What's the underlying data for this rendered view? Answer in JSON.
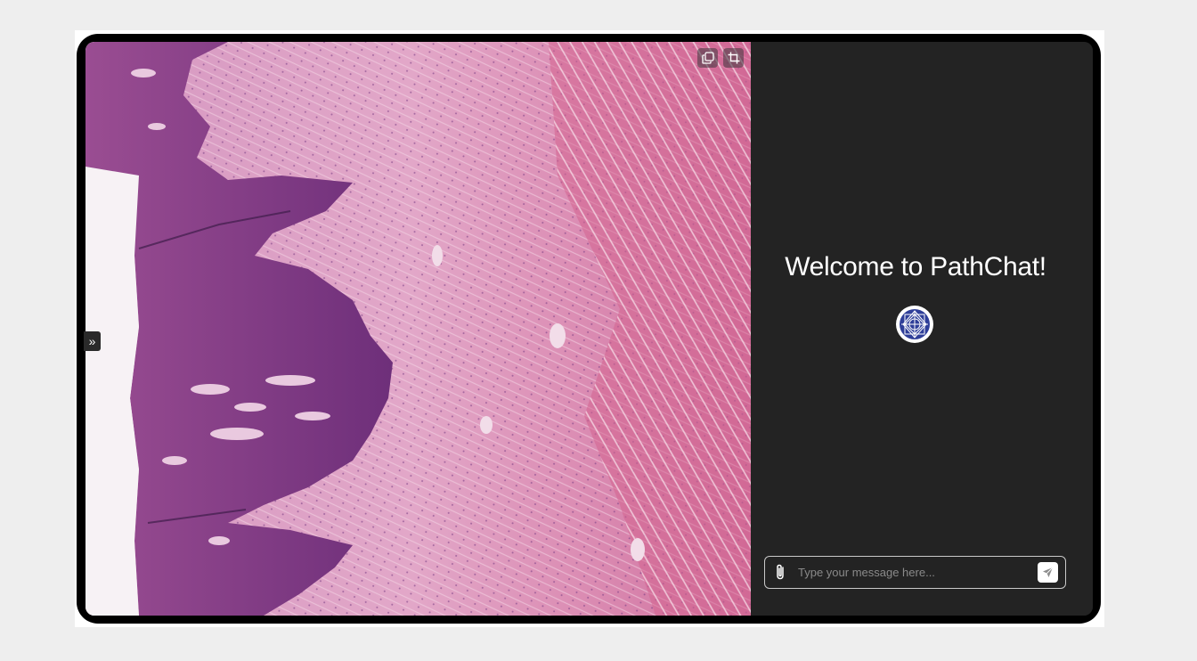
{
  "viewer": {
    "image": "H&E stained histology slide",
    "toolbar": [
      {
        "icon": "copy-icon"
      },
      {
        "icon": "crop-icon"
      }
    ],
    "sidebar_toggle": "»"
  },
  "chat": {
    "welcome": "Welcome to PathChat!",
    "logo_icon": "pathchat-logo-icon",
    "input_placeholder": "Type your message here...",
    "attach_icon": "paperclip-icon",
    "send_icon": "send-icon"
  },
  "colors": {
    "page_bg": "#eeeeee",
    "chat_bg": "#232323",
    "logo_blue": "#2f3f99"
  }
}
